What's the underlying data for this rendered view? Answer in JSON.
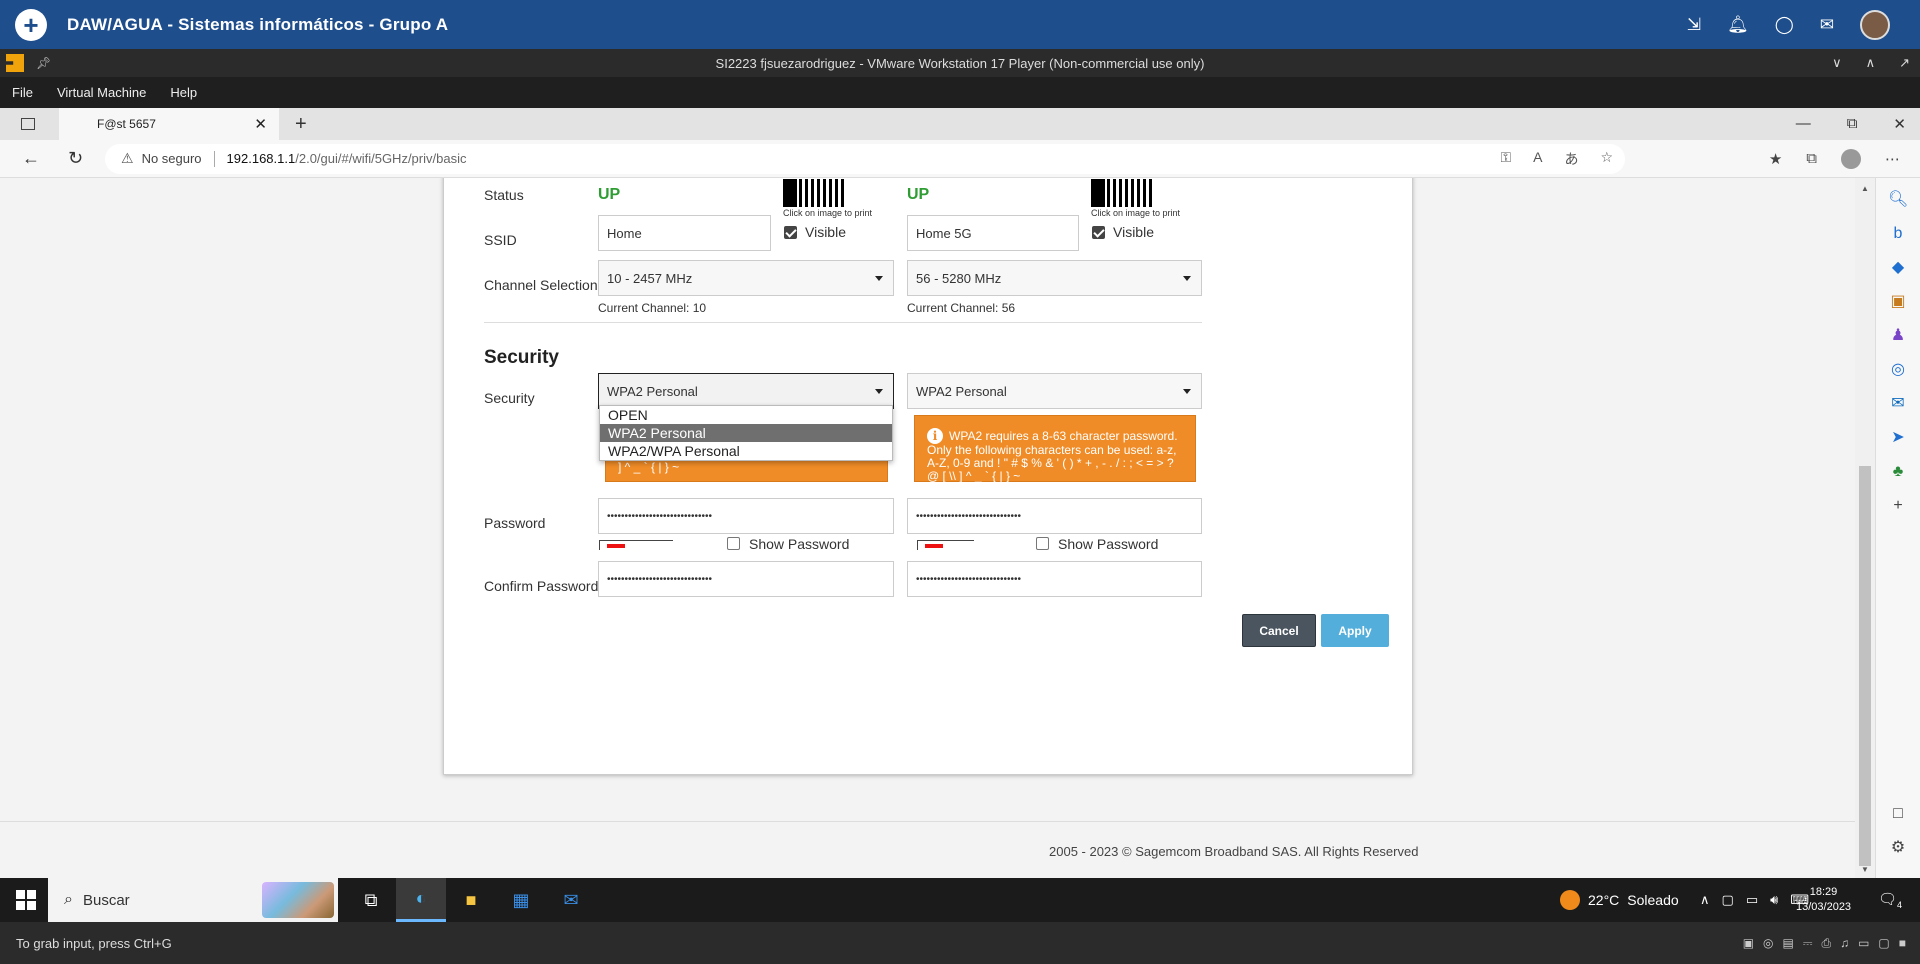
{
  "appbar": {
    "title": "DAW/AGUA - Sistemas informáticos - Grupo A",
    "icons": [
      "pin-icon",
      "bell-icon",
      "chat-icon",
      "mail-icon",
      "avatar"
    ]
  },
  "vmware": {
    "window_title": "SI2223 fjsuezarodriguez - VMware Workstation 17 Player (Non-commercial use only)",
    "menu": [
      "File",
      "Virtual Machine",
      "Help"
    ],
    "status_message": "To grab input, press Ctrl+G"
  },
  "browser": {
    "tab_title": "F@st 5657",
    "not_secure": "No seguro",
    "url_host": "192.168.1.1",
    "url_path": "/2.0/gui/#/wifi/5GHz/priv/basic"
  },
  "page": {
    "status_label": "Status",
    "ssid_label": "SSID",
    "channel_label": "Channel Selection",
    "security_heading": "Security",
    "security_label": "Security",
    "password_label": "Password",
    "confirm_label": "Confirm Password",
    "qr_caption": "Click on image to print",
    "visible_label": "Visible",
    "show_password_label": "Show Password",
    "cancel_label": "Cancel",
    "apply_label": "Apply",
    "band1": {
      "status": "UP",
      "ssid": "Home",
      "channel": "10 - 2457 MHz",
      "current_channel": "Current Channel: 10",
      "security": "WPA2 Personal",
      "alert_partial": "0-9 and ! \" # $ % & ' ( ) * + , - . / : ; < = > ? @ [ \\\\ ] ^ _ ` { | } ~",
      "password": "••••••••••••••••••••••••••••••",
      "confirm_password": "••••••••••••••••••••••••••••••"
    },
    "band2": {
      "status": "UP",
      "ssid": "Home 5G",
      "channel": "56 - 5280 MHz",
      "current_channel": "Current Channel: 56",
      "security": "WPA2 Personal",
      "alert": "WPA2 requires a 8-63 character password. Only the following characters can be used: a-z, A-Z, 0-9 and ! \" # $ % & ' ( ) * + , - . / : ; < = > ? @ [ \\\\ ] ^ _ ` { | } ~",
      "password": "••••••••••••••••••••••••••••••",
      "confirm_password": "••••••••••••••••••••••••••••••"
    },
    "dropdown_options": [
      "OPEN",
      "WPA2 Personal",
      "WPA2/WPA Personal"
    ],
    "dropdown_selected": "WPA2 Personal",
    "footer": "2005 - 2023 © Sagemcom Broadband SAS. All Rights Reserved"
  },
  "taskbar": {
    "search_placeholder": "Buscar",
    "temperature": "22°C",
    "weather": "Soleado",
    "time": "18:29",
    "date": "13/03/2023",
    "notification_count": "4"
  },
  "colors": {
    "appbar": "#1e4e8c",
    "status_up": "#2f9d33",
    "alert": "#f08c27",
    "apply": "#54aedb",
    "cancel": "#4a5560"
  }
}
